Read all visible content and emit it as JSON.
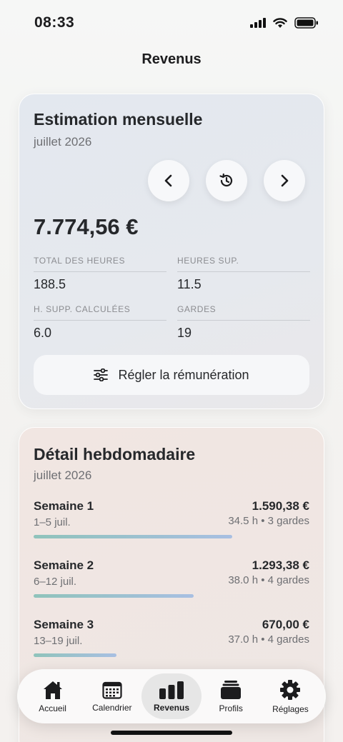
{
  "status_bar": {
    "time": "08:33"
  },
  "nav": {
    "title": "Revenus"
  },
  "estimation": {
    "title": "Estimation mensuelle",
    "month": "juillet 2026",
    "amount": "7.774,56 €",
    "stats": [
      {
        "label": "TOTAL DES HEURES",
        "value": "188.5"
      },
      {
        "label": "HEURES SUP.",
        "value": "11.5"
      },
      {
        "label": "H. SUPP. CALCULÉES",
        "value": "6.0"
      },
      {
        "label": "GARDES",
        "value": "19"
      }
    ],
    "adjust_label": "Régler la rémunération",
    "icons": {
      "prev": "chevron-left-icon",
      "history": "history-icon",
      "next": "chevron-right-icon",
      "adjust": "sliders-icon"
    }
  },
  "detail": {
    "title": "Détail hebdomadaire",
    "month": "juillet 2026",
    "weeks": [
      {
        "name": "Semaine 1",
        "range": "1–5 juil.",
        "amount": "1.590,38 €",
        "meta": "34.5 h • 3 gardes",
        "progress": 0.72
      },
      {
        "name": "Semaine 2",
        "range": "6–12 juil.",
        "amount": "1.293,38 €",
        "meta": "38.0 h • 4 gardes",
        "progress": 0.58
      },
      {
        "name": "Semaine 3",
        "range": "13–19 juil.",
        "amount": "670,00 €",
        "meta": "37.0 h • 4 gardes",
        "progress": 0.3
      }
    ]
  },
  "tabs": [
    {
      "label": "Accueil",
      "icon": "house-icon",
      "active": false
    },
    {
      "label": "Calendrier",
      "icon": "calendar-icon",
      "active": false
    },
    {
      "label": "Revenus",
      "icon": "bar-chart-icon",
      "active": true
    },
    {
      "label": "Profils",
      "icon": "stack-icon",
      "active": false
    },
    {
      "label": "Réglages",
      "icon": "gear-icon",
      "active": false
    }
  ],
  "colors": {
    "accent": "#1c1c1e",
    "progress_start": "#8fc3bb",
    "progress_end": "#a8bfe2"
  }
}
